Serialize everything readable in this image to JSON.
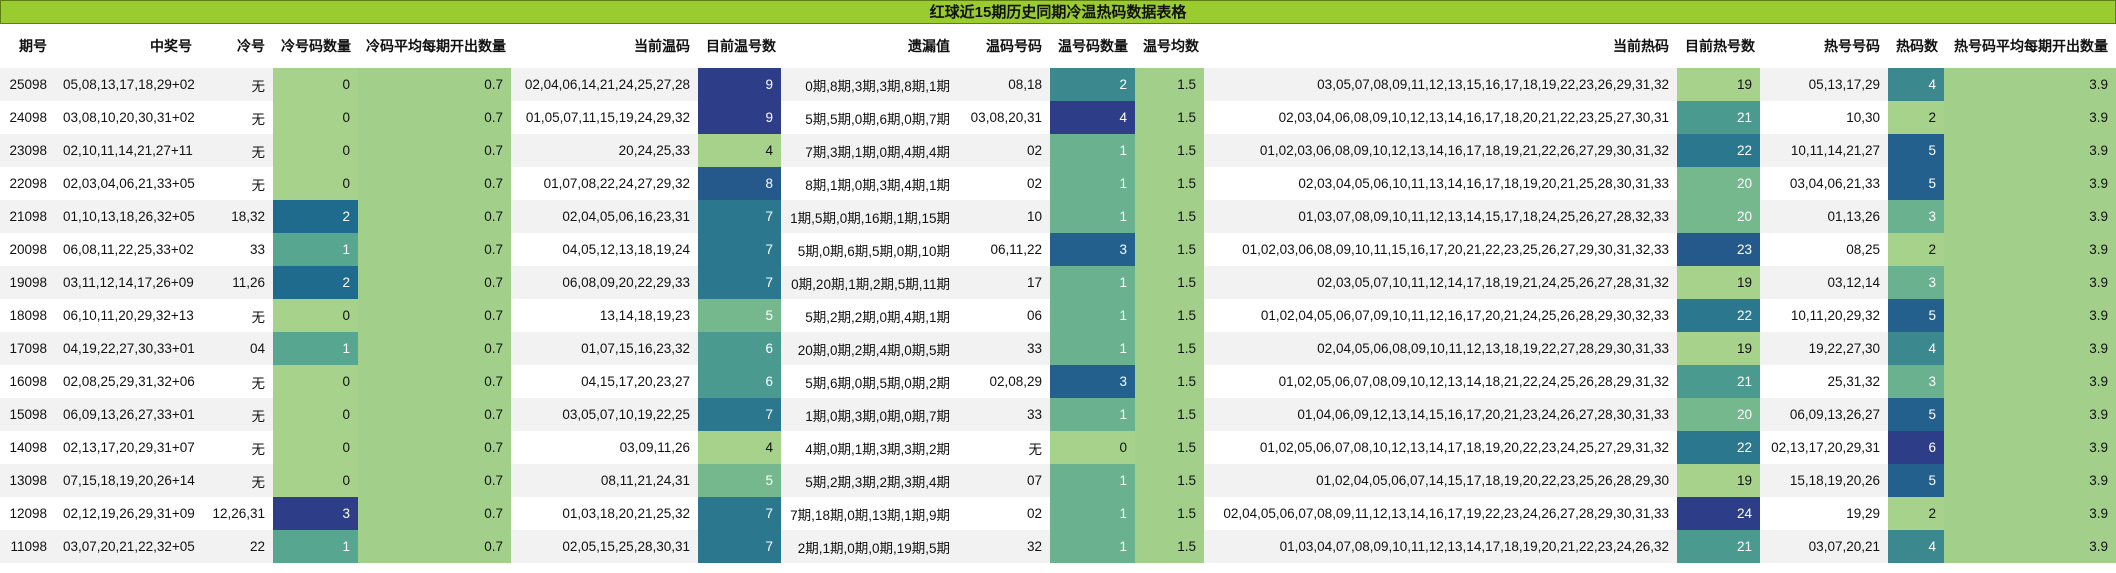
{
  "title": "红球近15期历史同期冷温热码数据表格",
  "headers": [
    "期号",
    "中奖号",
    "冷号",
    "冷号码数量",
    "冷码平均每期开出数量",
    "当前温码",
    "目前温号数",
    "遗漏值",
    "温码号码",
    "温号码数量",
    "温号均数",
    "当前热码",
    "目前热号数",
    "热号号码",
    "热码数",
    "热号码平均每期开出数量"
  ],
  "colors": {
    "title_bg": "#9bcc2f",
    "avg_bg": "#a2d08a",
    "scale": {
      "0": "#a7d28b",
      "1": "#56a690",
      "2": "#1f6b8e",
      "3": "#2e3d88"
    }
  },
  "rows": [
    [
      "25098",
      "05,08,13,17,18,29+02",
      "无",
      "0",
      "0.7",
      "02,04,06,14,21,24,25,27,28",
      "9",
      "0期,8期,3期,3期,8期,1期",
      "08,18",
      "2",
      "1.5",
      "03,05,07,08,09,11,12,13,15,16,17,18,19,22,23,26,29,31,32",
      "19",
      "05,13,17,29",
      "4",
      "3.9"
    ],
    [
      "24098",
      "03,08,10,20,30,31+02",
      "无",
      "0",
      "0.7",
      "01,05,07,11,15,19,24,29,32",
      "9",
      "5期,5期,0期,6期,0期,7期",
      "03,08,20,31",
      "4",
      "1.5",
      "02,03,04,06,08,09,10,12,13,14,16,17,18,20,21,22,23,25,27,30,31",
      "21",
      "10,30",
      "2",
      "3.9"
    ],
    [
      "23098",
      "02,10,11,14,21,27+11",
      "无",
      "0",
      "0.7",
      "20,24,25,33",
      "4",
      "7期,3期,1期,0期,4期,4期",
      "02",
      "1",
      "1.5",
      "01,02,03,06,08,09,10,12,13,14,16,17,18,19,21,22,26,27,29,30,31,32",
      "22",
      "10,11,14,21,27",
      "5",
      "3.9"
    ],
    [
      "22098",
      "02,03,04,06,21,33+05",
      "无",
      "0",
      "0.7",
      "01,07,08,22,24,27,29,32",
      "8",
      "8期,1期,0期,3期,4期,1期",
      "02",
      "1",
      "1.5",
      "02,03,04,05,06,10,11,13,14,16,17,18,19,20,21,25,28,30,31,33",
      "20",
      "03,04,06,21,33",
      "5",
      "3.9"
    ],
    [
      "21098",
      "01,10,13,18,26,32+05",
      "18,32",
      "2",
      "0.7",
      "02,04,05,06,16,23,31",
      "7",
      "1期,5期,0期,16期,1期,15期",
      "10",
      "1",
      "1.5",
      "01,03,07,08,09,10,11,12,13,14,15,17,18,24,25,26,27,28,32,33",
      "20",
      "01,13,26",
      "3",
      "3.9"
    ],
    [
      "20098",
      "06,08,11,22,25,33+02",
      "33",
      "1",
      "0.7",
      "04,05,12,13,18,19,24",
      "7",
      "5期,0期,6期,5期,0期,10期",
      "06,11,22",
      "3",
      "1.5",
      "01,02,03,06,08,09,10,11,15,16,17,20,21,22,23,25,26,27,29,30,31,32,33",
      "23",
      "08,25",
      "2",
      "3.9"
    ],
    [
      "19098",
      "03,11,12,14,17,26+09",
      "11,26",
      "2",
      "0.7",
      "06,08,09,20,22,29,33",
      "7",
      "0期,20期,1期,2期,5期,11期",
      "17",
      "1",
      "1.5",
      "02,03,05,07,10,11,12,14,17,18,19,21,24,25,26,27,28,31,32",
      "19",
      "03,12,14",
      "3",
      "3.9"
    ],
    [
      "18098",
      "06,10,11,20,29,32+13",
      "无",
      "0",
      "0.7",
      "13,14,18,19,23",
      "5",
      "5期,2期,2期,0期,4期,1期",
      "06",
      "1",
      "1.5",
      "01,02,04,05,06,07,09,10,11,12,16,17,20,21,24,25,26,28,29,30,32,33",
      "22",
      "10,11,20,29,32",
      "5",
      "3.9"
    ],
    [
      "17098",
      "04,19,22,27,30,33+01",
      "04",
      "1",
      "0.7",
      "01,07,15,16,23,32",
      "6",
      "20期,0期,2期,4期,0期,5期",
      "33",
      "1",
      "1.5",
      "02,04,05,06,08,09,10,11,12,13,18,19,22,27,28,29,30,31,33",
      "19",
      "19,22,27,30",
      "4",
      "3.9"
    ],
    [
      "16098",
      "02,08,25,29,31,32+06",
      "无",
      "0",
      "0.7",
      "04,15,17,20,23,27",
      "6",
      "5期,6期,0期,5期,0期,2期",
      "02,08,29",
      "3",
      "1.5",
      "01,02,05,06,07,08,09,10,12,13,14,18,21,22,24,25,26,28,29,31,32",
      "21",
      "25,31,32",
      "3",
      "3.9"
    ],
    [
      "15098",
      "06,09,13,26,27,33+01",
      "无",
      "0",
      "0.7",
      "03,05,07,10,19,22,25",
      "7",
      "1期,0期,3期,0期,0期,7期",
      "33",
      "1",
      "1.5",
      "01,04,06,09,12,13,14,15,16,17,20,21,23,24,26,27,28,30,31,33",
      "20",
      "06,09,13,26,27",
      "5",
      "3.9"
    ],
    [
      "14098",
      "02,13,17,20,29,31+07",
      "无",
      "0",
      "0.7",
      "03,09,11,26",
      "4",
      "4期,0期,1期,3期,3期,2期",
      "无",
      "0",
      "1.5",
      "01,02,05,06,07,08,10,12,13,14,17,18,19,20,22,23,24,25,27,29,31,32",
      "22",
      "02,13,17,20,29,31",
      "6",
      "3.9"
    ],
    [
      "13098",
      "07,15,18,19,20,26+14",
      "无",
      "0",
      "0.7",
      "08,11,21,24,31",
      "5",
      "5期,2期,3期,2期,3期,4期",
      "07",
      "1",
      "1.5",
      "01,02,04,05,06,07,14,15,17,18,19,20,22,23,25,26,28,29,30",
      "19",
      "15,18,19,20,26",
      "5",
      "3.9"
    ],
    [
      "12098",
      "02,12,19,26,29,31+09",
      "12,26,31",
      "3",
      "0.7",
      "01,03,18,20,21,25,32",
      "7",
      "7期,18期,0期,13期,1期,9期",
      "02",
      "1",
      "1.5",
      "02,04,05,06,07,08,09,11,12,13,14,16,17,19,22,23,24,26,27,28,29,30,31,33",
      "24",
      "19,29",
      "2",
      "3.9"
    ],
    [
      "11098",
      "03,07,20,21,22,32+05",
      "22",
      "1",
      "0.7",
      "02,05,15,25,28,30,31",
      "7",
      "2期,1期,0期,0期,19期,5期",
      "32",
      "1",
      "1.5",
      "01,03,04,07,08,09,10,11,12,13,14,17,18,19,20,21,22,23,24,26,32",
      "21",
      "03,07,20,21",
      "4",
      "3.9"
    ]
  ]
}
